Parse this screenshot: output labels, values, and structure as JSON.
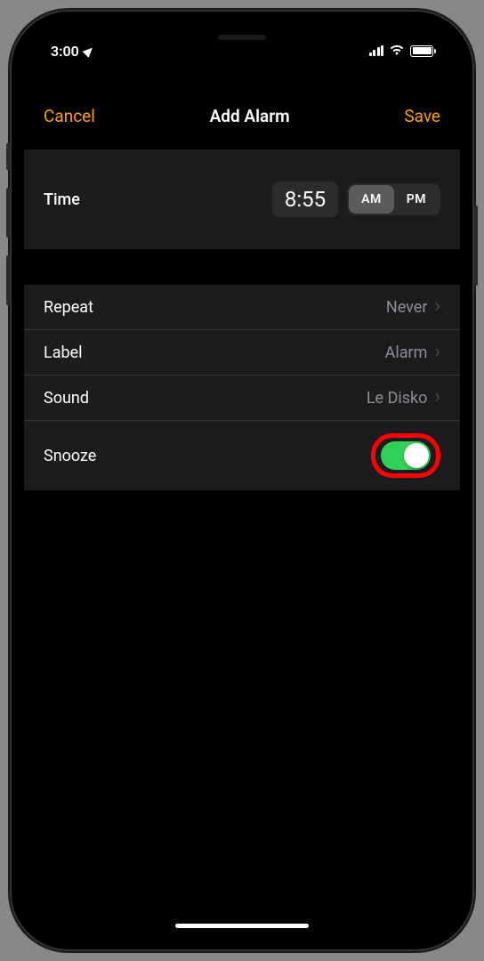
{
  "status": {
    "time": "3:00",
    "location_active": true
  },
  "nav": {
    "cancel": "Cancel",
    "title": "Add Alarm",
    "save": "Save"
  },
  "time_section": {
    "label": "Time",
    "value": "8:55",
    "am": "AM",
    "pm": "PM",
    "selected": "AM"
  },
  "rows": {
    "repeat": {
      "label": "Repeat",
      "value": "Never"
    },
    "label": {
      "label": "Label",
      "value": "Alarm"
    },
    "sound": {
      "label": "Sound",
      "value": "Le Disko"
    },
    "snooze": {
      "label": "Snooze",
      "on": true
    }
  },
  "highlight": "snooze-toggle",
  "colors": {
    "accent": "#FF9F0A",
    "toggle_on": "#30D158",
    "highlight_border": "#FF0000",
    "background": "#000000",
    "cell_bg": "#1C1C1E",
    "secondary_text": "#8E8E93"
  }
}
